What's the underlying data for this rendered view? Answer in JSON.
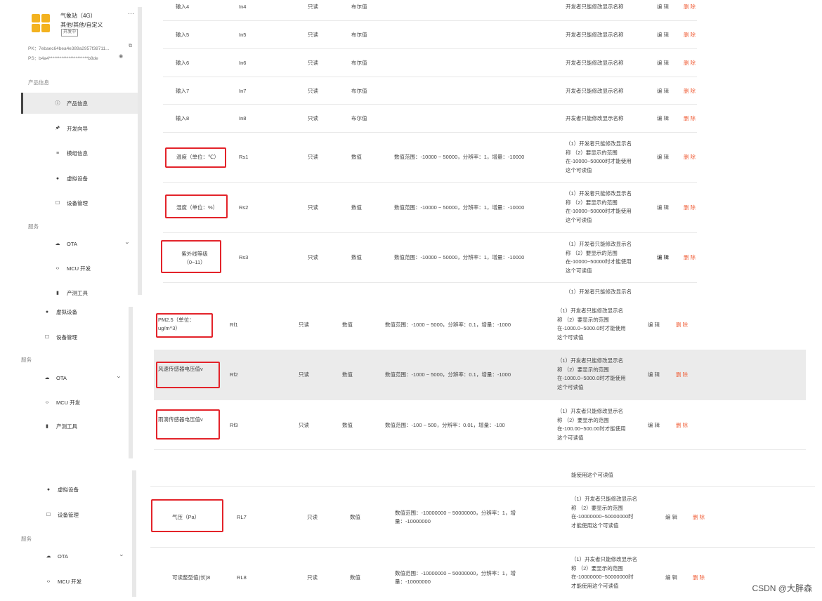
{
  "product": {
    "name": "气象站（4G）",
    "category": "其他/其他/自定义",
    "badge": "开发中",
    "menu_glyph": "···",
    "pk": "PK：7ebaec64bea4e389a2957f38711...",
    "ps": "PS：b4a4**********************b8de"
  },
  "sidebar_top": {
    "section_product": "产品信息",
    "items": [
      {
        "label": "产品信息",
        "icon": "info-icon"
      },
      {
        "label": "开发向导",
        "icon": "guide-icon"
      },
      {
        "label": "模组信息",
        "icon": "module-icon"
      },
      {
        "label": "虚拟设备",
        "icon": "virtual-device-icon"
      },
      {
        "label": "设备管理",
        "icon": "device-manage-icon"
      }
    ],
    "section_service": "服务",
    "services": [
      {
        "label": "OTA",
        "icon": "cloud-icon"
      },
      {
        "label": "MCU 开发",
        "icon": "code-icon"
      },
      {
        "label": "产测工具",
        "icon": "tool-icon"
      }
    ]
  },
  "sidebar_mid": {
    "items": [
      {
        "label": "虚拟设备"
      },
      {
        "label": "设备管理"
      }
    ],
    "section_service": "服务",
    "services": [
      {
        "label": "OTA"
      },
      {
        "label": "MCU 开发"
      },
      {
        "label": "产测工具"
      }
    ]
  },
  "sidebar_bottom": {
    "items": [
      {
        "label": "虚拟设备"
      },
      {
        "label": "设备管理"
      }
    ],
    "section_service": "服务",
    "services": [
      {
        "label": "OTA"
      },
      {
        "label": "MCU 开发"
      }
    ]
  },
  "actions": {
    "edit": "编辑",
    "delete": "删除"
  },
  "rows_top": [
    {
      "name": "输入4",
      "id": "In4",
      "access": "只读",
      "type": "布尔值",
      "range": "",
      "desc": "开发者只能修改显示名称"
    },
    {
      "name": "输入5",
      "id": "In5",
      "access": "只读",
      "type": "布尔值",
      "range": "",
      "desc": "开发者只能修改显示名称"
    },
    {
      "name": "输入6",
      "id": "In6",
      "access": "只读",
      "type": "布尔值",
      "range": "",
      "desc": "开发者只能修改显示名称"
    },
    {
      "name": "输入7",
      "id": "In7",
      "access": "只读",
      "type": "布尔值",
      "range": "",
      "desc": "开发者只能修改显示名称"
    },
    {
      "name": "输入8",
      "id": "In8",
      "access": "只读",
      "type": "布尔值",
      "range": "",
      "desc": "开发者只能修改显示名称"
    },
    {
      "name": "温度（单位：℃）",
      "id": "Rs1",
      "access": "只读",
      "type": "数值",
      "range": "数值范围：-10000 ~ 50000，分辨率：1，增量：-10000",
      "desc": "（1）开发者只能修改显示名称 （2）要显示的范围在-10000~50000时才能使用这个可读值"
    },
    {
      "name": "湿度（单位：%）",
      "id": "Rs2",
      "access": "只读",
      "type": "数值",
      "range": "数值范围：-10000 ~ 50000，分辨率：1，增量：-10000",
      "desc": "（1）开发者只能修改显示名称 （2）要显示的范围在-10000~50000时才能使用这个可读值"
    },
    {
      "name": "紫外线等级（0~11）",
      "id": "Rs3",
      "access": "只读",
      "type": "数值",
      "range": "数值范围：-10000 ~ 50000，分辨率：1，增量：-10000",
      "desc": "（1）开发者只能修改显示名称 （2）要显示的范围在-10000~50000时才能使用这个可读值"
    }
  ],
  "rows_mid": [
    {
      "name": "PM2.5（单位：ug/m^3）",
      "id": "Rf1",
      "access": "只读",
      "type": "数值",
      "range": "数值范围：-1000 ~ 5000，分辨率：0.1，增量：-1000",
      "desc": "（1）开发者只能修改显示名称 （2）要显示的范围在-1000.0~5000.0时才能使用这个可读值"
    },
    {
      "name": "风速传感器电压值v",
      "id": "Rf2",
      "access": "只读",
      "type": "数值",
      "range": "数值范围：-1000 ~ 5000，分辨率：0.1，增量：-1000",
      "desc": "（1）开发者只能修改显示名称 （2）要显示的范围在-1000.0~5000.0时才能使用这个可读值"
    },
    {
      "name": "雨滴传感器电压值v",
      "id": "Rf3",
      "access": "只读",
      "type": "数值",
      "range": "数值范围：-100 ~ 500，分辨率：0.01，增量：-100",
      "desc": "（1）开发者只能修改显示名称 （2）要显示的范围在-100.00~500.00时才能使用这个可读值"
    }
  ],
  "rows_bottom": [
    {
      "name": "气压（Pa）",
      "id": "RL7",
      "access": "只读",
      "type": "数值",
      "range": "数值范围：-10000000 ~ 50000000，分辨率：1，增量：-10000000",
      "desc": "（1）开发者只能修改显示名称 （2）要显示的范围在-10000000~50000000时才能使用这个可读值"
    },
    {
      "name": "可读整型值(长)8",
      "id": "RL8",
      "access": "只读",
      "type": "数值",
      "range": "数值范围：-10000000 ~ 50000000，分辨率：1，增量：-10000000",
      "desc": "（1）开发者只能修改显示名称 （2）要显示的范围在-10000000~50000000时才能使用这个可读值"
    }
  ],
  "fragments": {
    "desc_cut_top": "（1）开发者只能修改显示名称",
    "desc_cut_mid": "能使用这个可读值"
  },
  "watermark": "CSDN @大胖森"
}
